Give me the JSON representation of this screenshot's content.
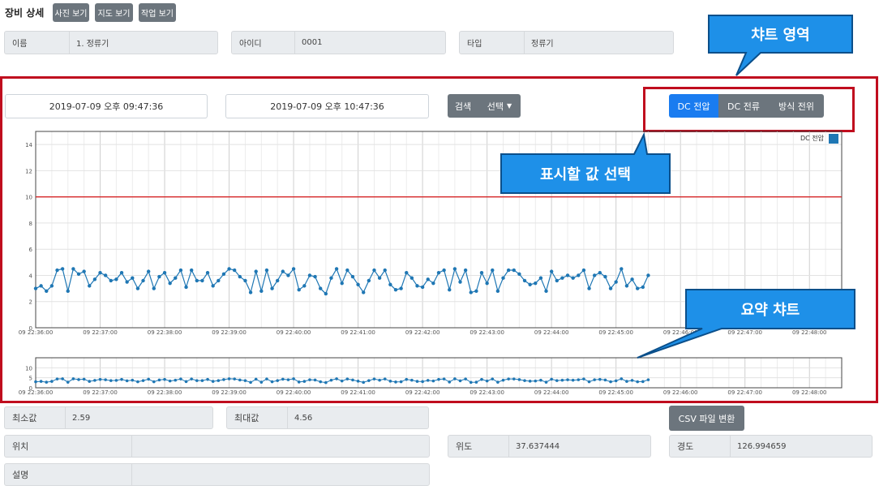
{
  "header": {
    "title": "장비 상세",
    "buttons": [
      "사진 보기",
      "지도 보기",
      "작업 보기"
    ]
  },
  "info": {
    "name": {
      "label": "이름",
      "value": "1. 정류기"
    },
    "id": {
      "label": "아이디",
      "value": "0001"
    },
    "type": {
      "label": "타입",
      "value": "정류기"
    }
  },
  "controls": {
    "start_datetime": "2019-07-09 오후 09:47:36",
    "end_datetime": "2019-07-09 오후 10:47:36",
    "search_label": "검색",
    "select_label": "선택",
    "value_buttons": [
      "DC 전압",
      "DC 전류",
      "방식 전위"
    ],
    "active_value": "DC 전압"
  },
  "annotations": {
    "chart_area": "챠트 영역",
    "select_value": "표시할 값 선택",
    "summary_chart": "요약 챠트"
  },
  "colors": {
    "series": "#1f77b4",
    "threshold": "#d62728",
    "primary": "#1a7cf0",
    "secondary": "#6c757d",
    "callout": "#1e90e8",
    "highlight_border": "#c00d1e"
  },
  "stats": {
    "min": {
      "label": "최소값",
      "value": "2.59"
    },
    "max": {
      "label": "최대값",
      "value": "4.56"
    },
    "csv_button": "CSV 파일 변환"
  },
  "location": {
    "position": {
      "label": "위치",
      "value": ""
    },
    "latitude": {
      "label": "위도",
      "value": "37.637444"
    },
    "longitude": {
      "label": "경도",
      "value": "126.994659"
    },
    "description": {
      "label": "설명",
      "value": ""
    }
  },
  "chart_data": [
    {
      "type": "line",
      "legend": [
        "DC 전압"
      ],
      "legend_position": "top-right",
      "ylim": [
        0,
        15
      ],
      "yticks": [
        0,
        2,
        4,
        6,
        8,
        10,
        12,
        14
      ],
      "xticks": [
        "09 22:36:00",
        "09 22:37:00",
        "09 22:38:00",
        "09 22:39:00",
        "09 22:40:00",
        "09 22:41:00",
        "09 22:42:00",
        "09 22:43:00",
        "09 22:44:00",
        "09 22:45:00",
        "09 22:46:00",
        "09 22:47:00",
        "09 22:48:00"
      ],
      "x_range_minutes": [
        0,
        12.5
      ],
      "threshold": 10,
      "grid": true,
      "series": [
        {
          "name": "DC 전압",
          "start_minute": 0,
          "step_seconds": 5,
          "values": [
            3.0,
            3.2,
            2.8,
            3.2,
            4.4,
            4.5,
            2.8,
            4.5,
            4.1,
            4.3,
            3.2,
            3.7,
            4.2,
            4.0,
            3.6,
            3.7,
            4.2,
            3.5,
            3.8,
            3.0,
            3.6,
            4.3,
            3.0,
            3.9,
            4.2,
            3.4,
            3.8,
            4.4,
            3.1,
            4.4,
            3.6,
            3.6,
            4.2,
            3.2,
            3.6,
            4.1,
            4.5,
            4.4,
            3.9,
            3.6,
            2.7,
            4.3,
            2.8,
            4.4,
            3.0,
            3.6,
            4.3,
            4.0,
            4.5,
            2.9,
            3.2,
            4.0,
            3.9,
            3.0,
            2.6,
            3.8,
            4.5,
            3.4,
            4.4,
            3.9,
            3.3,
            2.7,
            3.6,
            4.4,
            3.8,
            4.4,
            3.3,
            2.9,
            3.0,
            4.2,
            3.8,
            3.2,
            3.1,
            3.7,
            3.4,
            4.2,
            4.4,
            2.9,
            4.5,
            3.5,
            4.4,
            2.7,
            2.8,
            4.2,
            3.4,
            4.4,
            2.8,
            3.8,
            4.4,
            4.4,
            4.1,
            3.6,
            3.3,
            3.4,
            3.8,
            2.8,
            4.3,
            3.6,
            3.8,
            4.0,
            3.8,
            4.0,
            4.4,
            3.0,
            4.0,
            4.2,
            3.9,
            3.0,
            3.5,
            4.5,
            3.2,
            3.7,
            3.0,
            3.1,
            4.0
          ]
        }
      ]
    },
    {
      "type": "line",
      "role": "summary",
      "ylim": [
        0,
        15
      ],
      "yticks": [
        0,
        5,
        10
      ],
      "xticks": [
        "09 22:36:00",
        "09 22:37:00",
        "09 22:38:00",
        "09 22:39:00",
        "09 22:40:00",
        "09 22:41:00",
        "09 22:42:00",
        "09 22:43:00",
        "09 22:44:00",
        "09 22:45:00",
        "09 22:46:00",
        "09 22:47:00",
        "09 22:48:00"
      ],
      "x_range_minutes": [
        0,
        12.5
      ],
      "grid": true,
      "series_ref": "DC 전압"
    }
  ]
}
